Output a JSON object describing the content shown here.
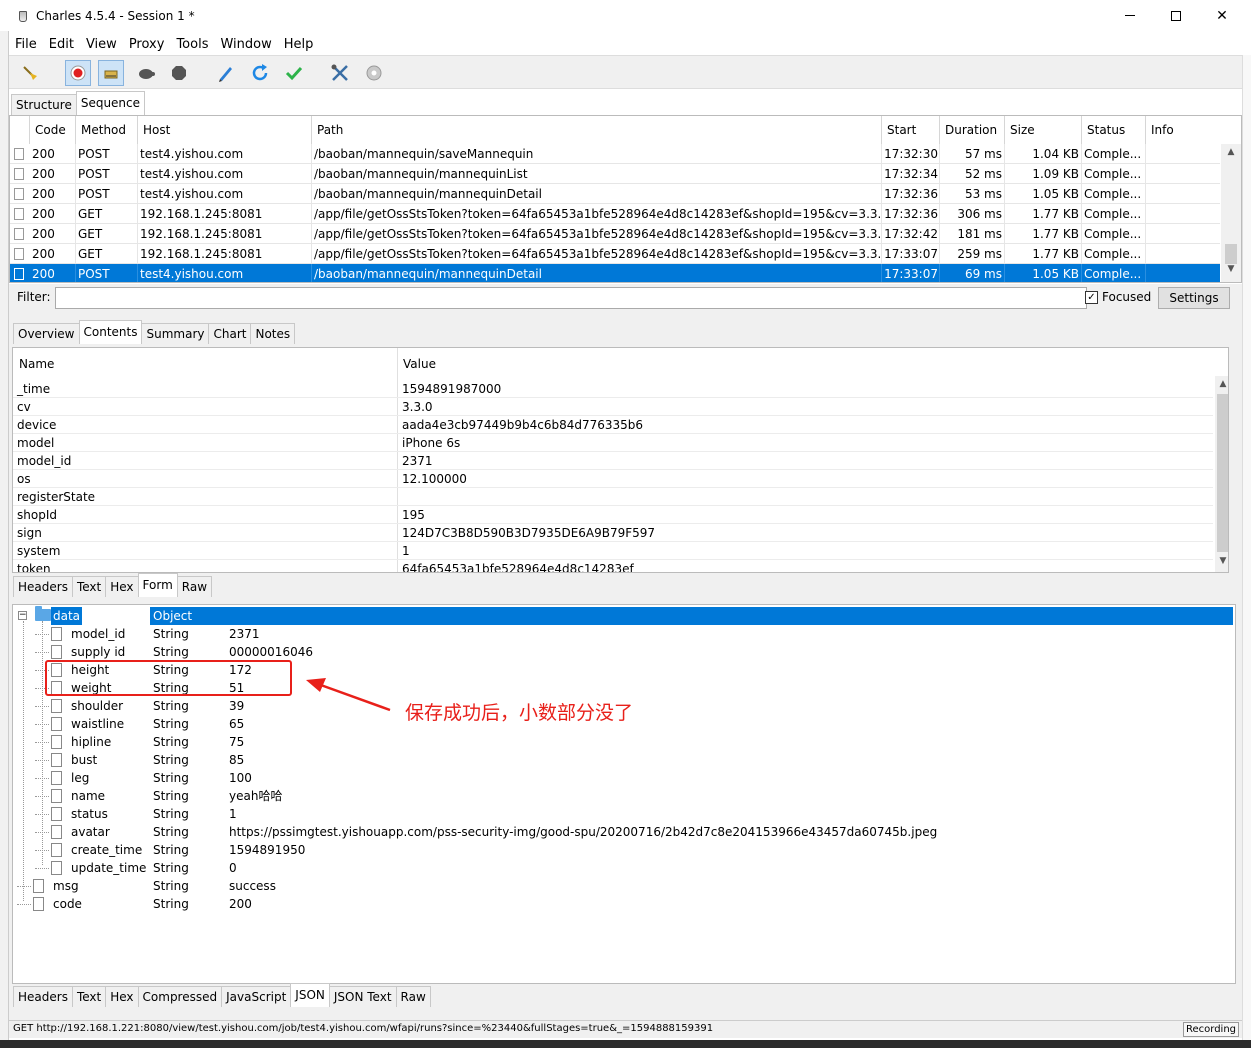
{
  "window": {
    "title": "Charles 4.5.4 - Session 1 *"
  },
  "menu": [
    "File",
    "Edit",
    "View",
    "Proxy",
    "Tools",
    "Window",
    "Help"
  ],
  "toolbar_icons": [
    "broom-icon",
    "record-icon",
    "throttle-icon",
    "turtle-icon",
    "stop-icon",
    "pen-icon",
    "refresh-icon",
    "check-icon",
    "tools-icon",
    "settings-gear-icon"
  ],
  "view_tabs": [
    "Structure",
    "Sequence"
  ],
  "sequence": {
    "columns": [
      "Code",
      "Method",
      "Host",
      "Path",
      "Start",
      "Duration",
      "Size",
      "Status",
      "Info"
    ],
    "rows": [
      {
        "code": "200",
        "method": "POST",
        "host": "test4.yishou.com",
        "path": "/baoban/mannequin/saveMannequin",
        "start": "17:32:30",
        "duration": "57 ms",
        "size": "1.04 KB",
        "status": "Comple..."
      },
      {
        "code": "200",
        "method": "POST",
        "host": "test4.yishou.com",
        "path": "/baoban/mannequin/mannequinList",
        "start": "17:32:34",
        "duration": "52 ms",
        "size": "1.09 KB",
        "status": "Comple..."
      },
      {
        "code": "200",
        "method": "POST",
        "host": "test4.yishou.com",
        "path": "/baoban/mannequin/mannequinDetail",
        "start": "17:32:36",
        "duration": "53 ms",
        "size": "1.05 KB",
        "status": "Comple..."
      },
      {
        "code": "200",
        "method": "GET",
        "host": "192.168.1.245:8081",
        "path": "/app/file/getOssStsToken?token=64fa65453a1bfe528964e4d8c14283ef&shopId=195&cv=3.3.0...",
        "start": "17:32:36",
        "duration": "306 ms",
        "size": "1.77 KB",
        "status": "Comple..."
      },
      {
        "code": "200",
        "method": "GET",
        "host": "192.168.1.245:8081",
        "path": "/app/file/getOssStsToken?token=64fa65453a1bfe528964e4d8c14283ef&shopId=195&cv=3.3.0...",
        "start": "17:32:42",
        "duration": "181 ms",
        "size": "1.77 KB",
        "status": "Comple..."
      },
      {
        "code": "200",
        "method": "GET",
        "host": "192.168.1.245:8081",
        "path": "/app/file/getOssStsToken?token=64fa65453a1bfe528964e4d8c14283ef&shopId=195&cv=3.3.0...",
        "start": "17:33:07",
        "duration": "259 ms",
        "size": "1.77 KB",
        "status": "Comple..."
      },
      {
        "code": "200",
        "method": "POST",
        "host": "test4.yishou.com",
        "path": "/baoban/mannequin/mannequinDetail",
        "start": "17:33:07",
        "duration": "69 ms",
        "size": "1.05 KB",
        "status": "Comple..."
      }
    ],
    "selected_index": 6
  },
  "filter": {
    "label": "Filter:",
    "value": "",
    "focused_label": "Focused",
    "focused_checked": true,
    "settings_label": "Settings"
  },
  "detail_tabs": [
    "Overview",
    "Contents",
    "Summary",
    "Chart",
    "Notes"
  ],
  "form": {
    "headers": [
      "Name",
      "Value"
    ],
    "rows": [
      {
        "name": "_time",
        "value": "1594891987000"
      },
      {
        "name": "cv",
        "value": "3.3.0"
      },
      {
        "name": "device",
        "value": "aada4e3cb97449b9b4c6b84d776335b6"
      },
      {
        "name": "model",
        "value": "iPhone 6s"
      },
      {
        "name": "model_id",
        "value": "2371"
      },
      {
        "name": "os",
        "value": "12.100000"
      },
      {
        "name": "registerState",
        "value": ""
      },
      {
        "name": "shopId",
        "value": "195"
      },
      {
        "name": "sign",
        "value": "124D7C3B8D590B3D7935DE6A9B79F597"
      },
      {
        "name": "system",
        "value": "1"
      },
      {
        "name": "token",
        "value": "64fa65453a1bfe528964e4d8c14283ef"
      }
    ]
  },
  "request_tabs": [
    "Headers",
    "Text",
    "Hex",
    "Form",
    "Raw"
  ],
  "json_tree": {
    "root": {
      "name": "data",
      "type": "Object"
    },
    "children": [
      {
        "name": "model_id",
        "type": "String",
        "value": "2371"
      },
      {
        "name": "supply id",
        "type": "String",
        "value": "00000016046"
      },
      {
        "name": "height",
        "type": "String",
        "value": "172"
      },
      {
        "name": "weight",
        "type": "String",
        "value": "51"
      },
      {
        "name": "shoulder",
        "type": "String",
        "value": "39"
      },
      {
        "name": "waistline",
        "type": "String",
        "value": "65"
      },
      {
        "name": "hipline",
        "type": "String",
        "value": "75"
      },
      {
        "name": "bust",
        "type": "String",
        "value": "85"
      },
      {
        "name": "leg",
        "type": "String",
        "value": "100"
      },
      {
        "name": "name",
        "type": "String",
        "value": "yeah哈哈"
      },
      {
        "name": "status",
        "type": "String",
        "value": "1"
      },
      {
        "name": "avatar",
        "type": "String",
        "value": "https://pssimgtest.yishouapp.com/pss-security-img/good-spu/20200716/2b42d7c8e204153966e43457da60745b.jpeg"
      },
      {
        "name": "create_time",
        "type": "String",
        "value": "1594891950"
      },
      {
        "name": "update_time",
        "type": "String",
        "value": "0"
      }
    ],
    "siblings": [
      {
        "name": "msg",
        "type": "String",
        "value": "success"
      },
      {
        "name": "code",
        "type": "String",
        "value": "200"
      }
    ]
  },
  "response_tabs": [
    "Headers",
    "Text",
    "Hex",
    "Compressed",
    "JavaScript",
    "JSON",
    "JSON Text",
    "Raw"
  ],
  "status": {
    "message": "GET http://192.168.1.221:8080/view/test.yishou.com/job/test4.yishou.com/wfapi/runs?since=%23440&fullStages=true&_=1594888159391",
    "recording_label": "Recording"
  },
  "annotation": {
    "text": "保存成功后，小数部分没了",
    "color": "#e8201a"
  }
}
